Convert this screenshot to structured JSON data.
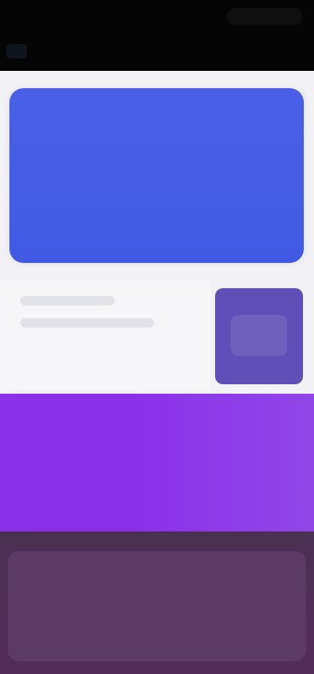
{
  "header": {
    "title": "",
    "status": ""
  },
  "hero_card": {
    "title": "",
    "value": "",
    "subtitle": ""
  },
  "middle_row": {
    "left_text_1": "",
    "left_text_2": "",
    "right_tile_label": ""
  },
  "promo_banner": {
    "value": "",
    "subtitle": ""
  },
  "bottom_card": {
    "title": "",
    "value": ""
  },
  "colors": {
    "header_bg": "#050505",
    "hero_blue": "#4a5fe6",
    "tile_purple": "#5f4fb6",
    "banner_purple": "#8a31ea",
    "bottom_plum": "#542c5a",
    "page_white": "#f2f2f6"
  }
}
